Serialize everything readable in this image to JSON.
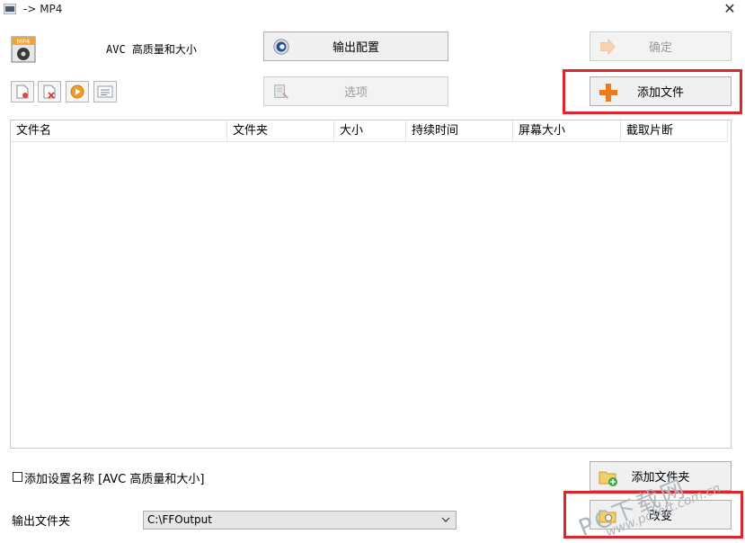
{
  "window": {
    "title": "-> MP4",
    "close_label": "✕"
  },
  "profile": {
    "label": "AVC 高质量和大小"
  },
  "toolbar": {
    "output_config_label": "输出配置",
    "options_label": "选项",
    "ok_label": "确定",
    "add_file_label": "添加文件",
    "add_folder_label": "添加文件夹",
    "change_label": "改变"
  },
  "small_buttons": [
    "remove-icon",
    "clear-icon",
    "play-icon",
    "info-icon"
  ],
  "file_list": {
    "columns": [
      "文件名",
      "文件夹",
      "大小",
      "持续时间",
      "屏幕大小",
      "截取片断"
    ],
    "rows": []
  },
  "settings": {
    "add_setting_name_label": "添加设置名称 [AVC 高质量和大小]",
    "add_setting_name_checked": false,
    "output_folder_label": "输出文件夹",
    "output_folder_value": "C:\\FFOutput"
  },
  "watermark": {
    "brand": "PC下载网",
    "url": "www.pcsoft.com.cn"
  },
  "colors": {
    "highlight": "#e0242b",
    "add_icon": "#f07a1a",
    "config_icon": "#1f4f9a"
  }
}
